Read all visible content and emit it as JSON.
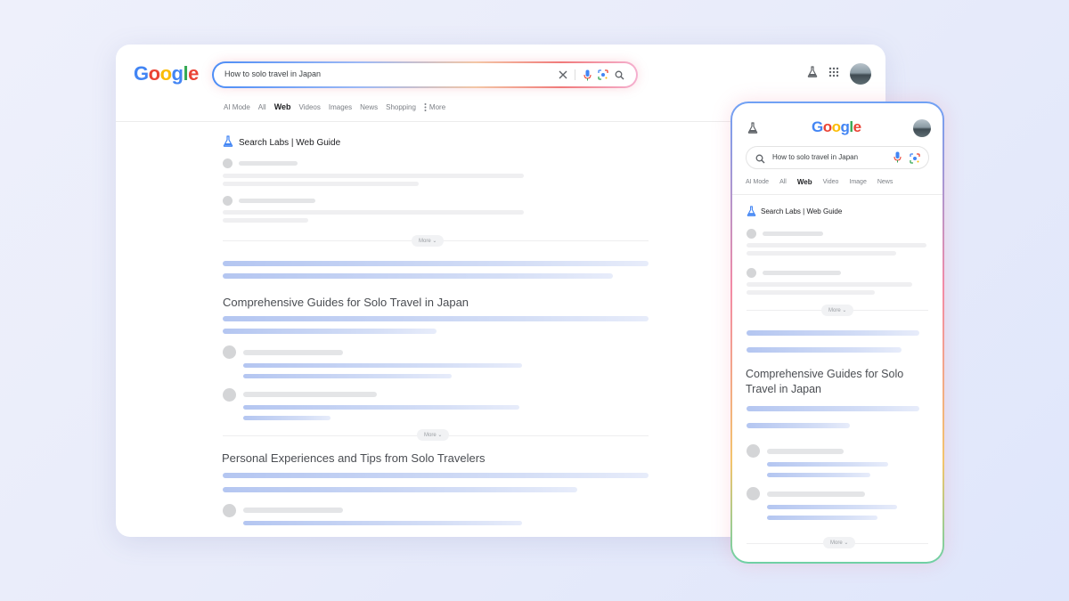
{
  "desktop": {
    "search": {
      "query": "How to solo travel in Japan"
    },
    "tabs": [
      "AI Mode",
      "All",
      "Web",
      "Videos",
      "Images",
      "News",
      "Shopping",
      "More"
    ],
    "active_tab": "Web",
    "labs_label": "Search Labs | Web Guide",
    "more_label": "More",
    "section1_title": "Comprehensive Guides for Solo Travel in Japan",
    "section2_title": "Personal Experiences and Tips from Solo Travelers"
  },
  "mobile": {
    "search": {
      "query": "How to solo travel in Japan"
    },
    "tabs": [
      "AI Mode",
      "All",
      "Web",
      "Video",
      "Image",
      "News"
    ],
    "active_tab": "Web",
    "labs_label": "Search Labs | Web Guide",
    "more_label": "More",
    "section1_title": "Comprehensive Guides for Solo Travel in Japan"
  },
  "logo": {
    "letters": [
      "G",
      "o",
      "o",
      "g",
      "l",
      "e"
    ]
  },
  "colors": {
    "google_blue": "#4285f4",
    "google_red": "#ea4335",
    "google_yellow": "#fbbc05",
    "google_green": "#34a853",
    "placeholder_blue": "#b4c6f1",
    "placeholder_gray": "#e4e5e7"
  },
  "icons": {
    "clear": "close-icon",
    "voice": "microphone-icon",
    "lens": "lens-icon",
    "search": "search-icon",
    "labs": "flask-icon",
    "apps": "apps-grid-icon",
    "more": "more-vert-icon"
  }
}
